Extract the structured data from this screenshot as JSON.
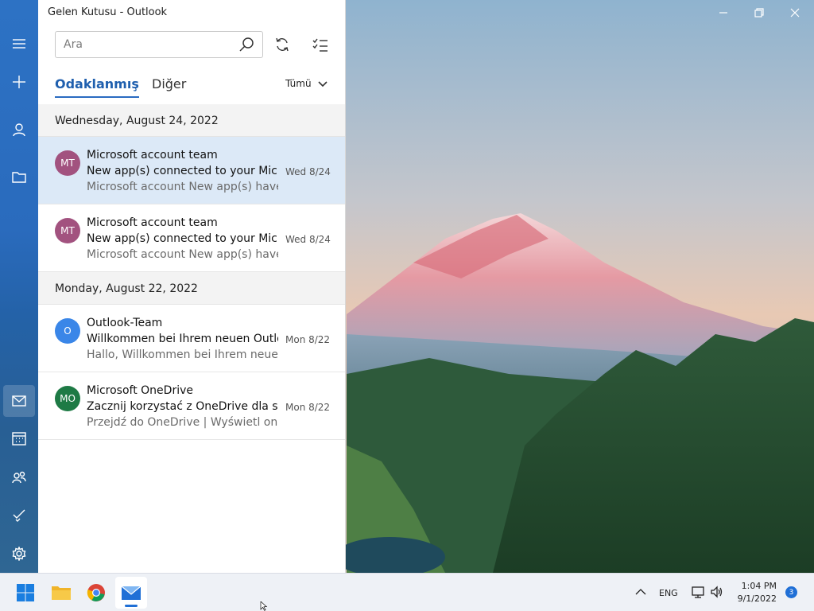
{
  "window": {
    "title": "Gelen Kutusu - Outlook",
    "controls": [
      "minimize-icon",
      "restore-icon",
      "close-icon"
    ]
  },
  "search": {
    "placeholder": "Ara"
  },
  "tabs": {
    "focused": "Odaklanmış",
    "other": "Diğer",
    "filter": "Tümü"
  },
  "groups": [
    {
      "date": "Wednesday, August 24, 2022",
      "messages": [
        {
          "initials": "MT",
          "avatar_color": "#a2527f",
          "sender": "Microsoft account team",
          "subject": "New app(s) connected to your Microsoft account",
          "preview": "Microsoft account New app(s) have access to your data",
          "date": "Wed 8/24",
          "selected": true
        },
        {
          "initials": "MT",
          "avatar_color": "#a2527f",
          "sender": "Microsoft account team",
          "subject": "New app(s) connected to your Microsoft account",
          "preview": "Microsoft account New app(s) have access to your data",
          "date": "Wed 8/24",
          "selected": false
        }
      ]
    },
    {
      "date": "Monday, August 22, 2022",
      "messages": [
        {
          "initials": "O",
          "avatar_color": "#3a86e8",
          "sender": "Outlook-Team",
          "subject": "Willkommen bei Ihrem neuen Outlook.com-Konto",
          "preview": "Hallo, Willkommen bei Ihrem neuen Outlook.com-Konto",
          "date": "Mon 8/22",
          "selected": false
        },
        {
          "initials": "MO",
          "avatar_color": "#1e7a45",
          "sender": "Microsoft OneDrive",
          "subject": "Zacznij korzystać z OneDrive dla systemu Windows",
          "preview": "Przejdź do OneDrive | Wyświetl online",
          "date": "Mon 8/22",
          "selected": false
        }
      ]
    }
  ],
  "rail": {
    "top": [
      "hamburger-menu-icon",
      "compose-plus-icon",
      "accounts-person-icon",
      "folders-icon"
    ],
    "bottom": [
      "mail-icon",
      "calendar-icon",
      "people-icon",
      "todo-check-icon",
      "settings-gear-icon"
    ]
  },
  "taskbar": {
    "apps": [
      "windows-start-icon",
      "file-explorer-icon",
      "chrome-icon",
      "mail-app-icon"
    ],
    "language": "ENG",
    "time": "1:04 PM",
    "date": "9/1/2022",
    "notifications": "3"
  }
}
